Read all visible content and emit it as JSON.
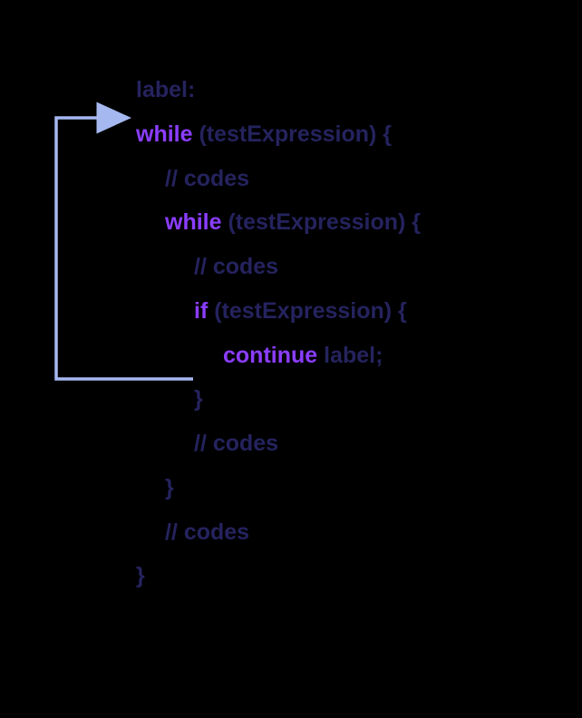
{
  "diagram": {
    "line1": {
      "label": "label:"
    },
    "line2": {
      "kw": "while",
      "rest": " (testExpression) {"
    },
    "line3": {
      "comment": "// codes"
    },
    "line4": {
      "kw": "while",
      "rest": " (testExpression) {"
    },
    "line5": {
      "comment": "// codes"
    },
    "line6": {
      "kw": "if",
      "rest": " (testExpression) {"
    },
    "line7": {
      "kw": "continue",
      "rest": " label;"
    },
    "line8": {
      "brace": "}"
    },
    "line9": {
      "comment": "// codes"
    },
    "line10": {
      "brace": "}"
    },
    "line11": {
      "comment": "// codes"
    },
    "line12": {
      "brace": "}"
    }
  },
  "colors": {
    "keyword": "#8b3dff",
    "text": "#25235e",
    "arrow": "#a5b8f0"
  }
}
